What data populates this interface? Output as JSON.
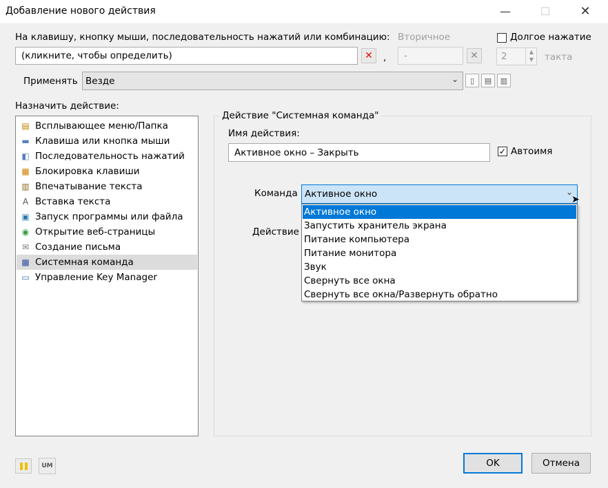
{
  "window": {
    "title": "Добавление нового действия"
  },
  "hotkey": {
    "prompt": "На клавишу, кнопку мыши, последовательность нажатий или комбинацию:",
    "primary_value": "(кликните, чтобы определить)",
    "separator": ",",
    "secondary_label": "Вторичное",
    "secondary_value": "-",
    "long_press_label": "Долгое нажатие",
    "long_press_count": "2",
    "ticks_label": "такта"
  },
  "apply": {
    "label": "Применять",
    "value": "Везде"
  },
  "actions": {
    "label": "Назначить действие:",
    "items": [
      {
        "label": "Всплывающее меню/Папка",
        "icon": "folder-menu-icon",
        "glyph": "▤",
        "color": "#c08000"
      },
      {
        "label": "Клавиша или кнопка мыши",
        "icon": "key-icon",
        "glyph": "▬",
        "color": "#5a7fc0"
      },
      {
        "label": "Последовательность нажатий",
        "icon": "keys-sequence-icon",
        "glyph": "◧",
        "color": "#5a7fc0"
      },
      {
        "label": "Блокировка клавиши",
        "icon": "lock-key-icon",
        "glyph": "▦",
        "color": "#d08000"
      },
      {
        "label": "Впечатывание текста",
        "icon": "type-text-icon",
        "glyph": "▥",
        "color": "#8a6a20"
      },
      {
        "label": "Вставка текста",
        "icon": "paste-text-icon",
        "glyph": "A",
        "color": "#555555"
      },
      {
        "label": "Запуск программы или файла",
        "icon": "run-program-icon",
        "glyph": "▣",
        "color": "#2a7ab0"
      },
      {
        "label": "Открытие веб-страницы",
        "icon": "globe-icon",
        "glyph": "◉",
        "color": "#3a9a40"
      },
      {
        "label": "Создание письма",
        "icon": "envelope-icon",
        "glyph": "✉",
        "color": "#777777"
      },
      {
        "label": "Системная команда",
        "icon": "system-command-icon",
        "glyph": "▩",
        "color": "#3050a0"
      },
      {
        "label": "Управление Key Manager",
        "icon": "key-manager-icon",
        "glyph": "▭",
        "color": "#3a6ab0"
      }
    ],
    "selected": "Системная команда"
  },
  "panel": {
    "title": "Действие \"Системная команда\"",
    "name_label": "Имя действия:",
    "name_value": "Активное окно – Закрыть",
    "autoname_label": "Автоимя",
    "command_label": "Команда",
    "command_value": "Активное окно",
    "action_label": "Действие",
    "dropdown_options": [
      "Активное окно",
      "Запустить хранитель экрана",
      "Питание компьютера",
      "Питание монитора",
      "Звук",
      "Свернуть все окна",
      "Свернуть все окна/Развернуть обратно"
    ]
  },
  "footer": {
    "ok": "OK",
    "cancel": "Отмена",
    "um": "UM"
  },
  "colors": {
    "accent": "#0078d7",
    "clear_x": "#e01010"
  }
}
